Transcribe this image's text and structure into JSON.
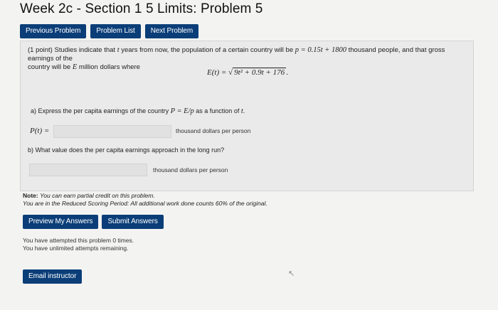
{
  "header": {
    "title": "Week 2c - Section 1 5 Limits: Problem 5"
  },
  "nav": {
    "previous": "Previous Problem",
    "list": "Problem List",
    "next": "Next Problem"
  },
  "problem": {
    "intro_a": "(1 point) Studies indicate that",
    "var_t": "t",
    "intro_b": "years from now, the population of a certain country will be",
    "pop_formula": "p = 0.15t + 1800",
    "intro_c": "thousand people, and that gross earnings of the",
    "intro_d": "country will be",
    "var_E": "E",
    "intro_e": "million dollars where",
    "earnings_lhs": "E(t) = ",
    "earnings_radicand": "9t² + 0.9t + 176",
    "earnings_end": ".",
    "part_a_text": "a) Express the per capita earnings of the country",
    "part_a_formula": "P = E/p",
    "part_a_tail": "as a function of",
    "part_a_var": "t",
    "part_a_dot": ".",
    "pt_label": "P(t) =",
    "part_a_unit": "thousand dollars per person",
    "part_b_text": "b) What value does the per capita earnings approach in the long run?",
    "part_b_unit": "thousand dollars per person"
  },
  "note": {
    "label": "Note:",
    "line1": "You can earn partial credit on this problem.",
    "line2_a": "You are in the",
    "line2_b": "Reduced Scoring Period",
    "line2_c": ": All additional work done counts 60% of the original."
  },
  "actions": {
    "preview": "Preview My Answers",
    "submit": "Submit Answers"
  },
  "attempts": {
    "line1": "You have attempted this problem 0 times.",
    "line2": "You have unlimited attempts remaining."
  },
  "email": {
    "label": "Email instructor"
  }
}
